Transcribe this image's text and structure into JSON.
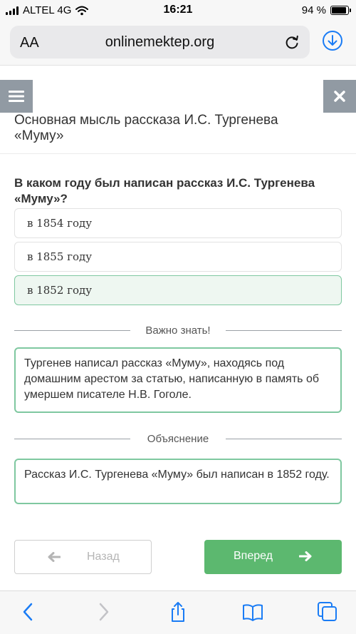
{
  "status_bar": {
    "carrier": "ALTEL 4G",
    "time": "16:21",
    "battery": "94 %"
  },
  "browser": {
    "text_size_label": "AA",
    "url": "onlinemektep.org"
  },
  "lesson": {
    "title": "Основная мысль рассказа И.С. Тургенева «Муму»"
  },
  "question": {
    "text": "В каком году был написан рассказ И.С. Тургенева «Муму»?",
    "options": [
      {
        "label": "в 1854 году"
      },
      {
        "label": "в 1855 году"
      },
      {
        "label": "в 1852 году"
      }
    ]
  },
  "important": {
    "heading": "Важно знать!",
    "text": "Тургенев написал рассказ «Муму», находясь под домашним арестом за статью, написанную в память об умершем писателе Н.В. Гоголе."
  },
  "explanation": {
    "heading": "Объяснение",
    "text": "Рассказ И.С. Тургенева «Муму» был написан в 1852 году."
  },
  "nav": {
    "back_label": "Назад",
    "next_label": "Вперед"
  },
  "colors": {
    "accent_green": "#5cb86f",
    "correct_border": "#7fc8a0",
    "correct_bg": "#eef7f1",
    "ios_blue": "#1a7cf5",
    "header_button_gray": "#919aa3"
  },
  "icons": {
    "menu": "hamburger-icon",
    "close": "close-icon",
    "reload": "reload-icon",
    "download": "download-icon",
    "back_arrow": "arrow-left-icon",
    "next_arrow": "arrow-right-icon",
    "toolbar": [
      "chevron-left-icon",
      "chevron-right-icon",
      "share-icon",
      "bookmarks-icon",
      "tabs-icon"
    ]
  }
}
